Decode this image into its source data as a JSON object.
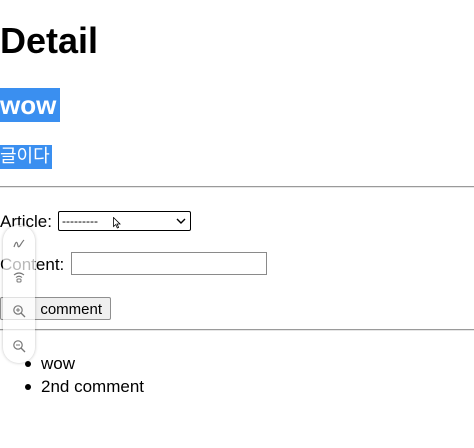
{
  "page": {
    "heading": "Detail",
    "article_title": "wow",
    "article_content": "글이다"
  },
  "form": {
    "article_label": "Article:",
    "article_selected": "---------",
    "content_label": "Content:",
    "content_value": "",
    "submit_label": "comment"
  },
  "comments": [
    "wow",
    "2nd comment"
  ],
  "toolbar": {
    "icons": [
      "pen-icon",
      "wave-icon",
      "zoom-in-icon",
      "zoom-out-icon"
    ]
  },
  "colors": {
    "highlight": "#3a8ff0"
  }
}
